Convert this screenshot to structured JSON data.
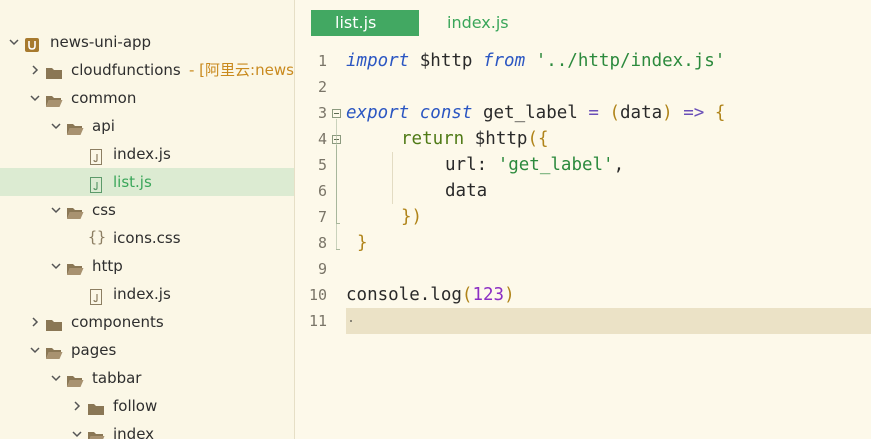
{
  "sidebar": {
    "items": [
      {
        "label": "news-uni-app",
        "icon": "project-icon",
        "expanded": true
      },
      {
        "label": "cloudfunctions",
        "annotation": "- [阿里云:news-u",
        "icon": "folder-icon",
        "expanded": false
      },
      {
        "label": "common",
        "icon": "folder-icon",
        "expanded": true
      },
      {
        "label": "api",
        "icon": "folder-icon",
        "expanded": true
      },
      {
        "label": "index.js",
        "icon": "js-file-icon"
      },
      {
        "label": "list.js",
        "icon": "js-file-icon",
        "selected": true
      },
      {
        "label": "css",
        "icon": "folder-icon",
        "expanded": true
      },
      {
        "label": "icons.css",
        "icon": "css-file-icon"
      },
      {
        "label": "http",
        "icon": "folder-icon",
        "expanded": true
      },
      {
        "label": "index.js",
        "icon": "js-file-icon"
      },
      {
        "label": "components",
        "icon": "folder-icon",
        "expanded": false
      },
      {
        "label": "pages",
        "icon": "folder-icon",
        "expanded": true
      },
      {
        "label": "tabbar",
        "icon": "folder-icon",
        "expanded": true
      },
      {
        "label": "follow",
        "icon": "folder-icon",
        "expanded": false
      },
      {
        "label": "index",
        "icon": "folder-icon",
        "expanded": true
      }
    ]
  },
  "editor": {
    "tabs": [
      {
        "label": "list.js",
        "active": true
      },
      {
        "label": "index.js",
        "active": false
      }
    ],
    "line_numbers": [
      "1",
      "2",
      "3",
      "4",
      "5",
      "6",
      "7",
      "8",
      "9",
      "10",
      "11"
    ],
    "code": {
      "l1": {
        "kw1": "import",
        "t1": " $http ",
        "kw2": "from",
        "t2": " ",
        "str": "'../http/index.js'"
      },
      "l3": {
        "kw1": "export",
        "t1": " ",
        "kw2": "const",
        "t2": " get_label ",
        "op1": "=",
        "t3": " ",
        "p1": "(",
        "t4": "data",
        "p2": ")",
        "t5": " ",
        "op2": "=>",
        "t6": " ",
        "p3": "{"
      },
      "l4": {
        "kw": "return",
        "t1": " $http",
        "p1": "(",
        "p2": "{"
      },
      "l5": {
        "t1": "url: ",
        "str": "'get_label'",
        "t2": ","
      },
      "l6": {
        "t1": "data"
      },
      "l7": {
        "p1": "}",
        "p2": ")"
      },
      "l8": {
        "p1": "}"
      },
      "l10": {
        "t1": "console.log",
        "p1": "(",
        "num": "123",
        "p2": ")"
      }
    },
    "current_line": "11"
  },
  "colors": {
    "accent": "#42a862",
    "selected_row": "#dcebd2",
    "current_line": "#ebe2c6",
    "background": "#fdf9ea"
  }
}
